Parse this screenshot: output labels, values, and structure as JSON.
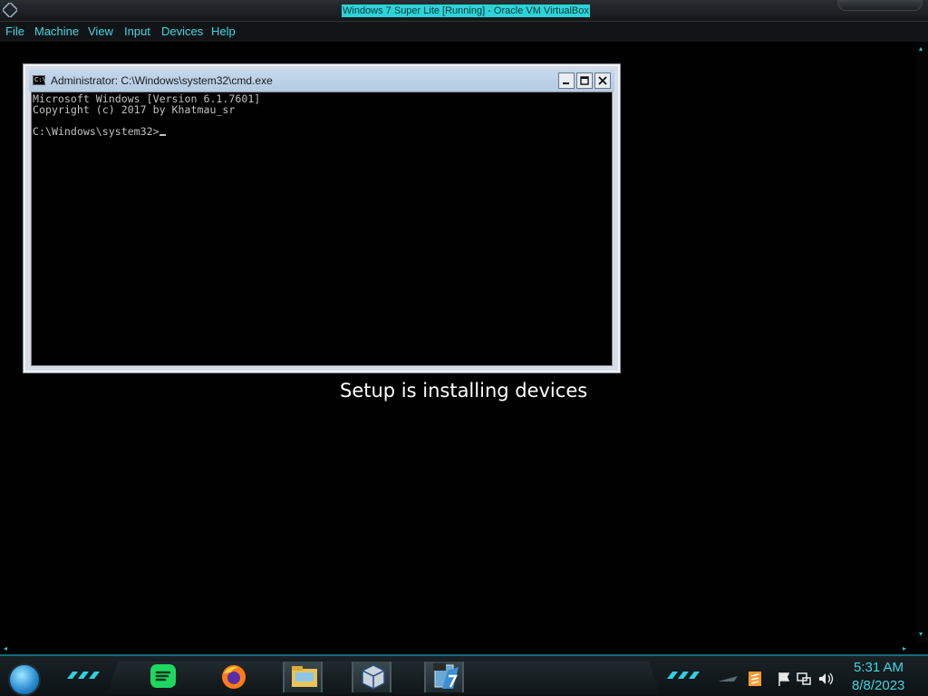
{
  "host": {
    "title": "Windows 7 Super Lite [Running] - Oracle VM VirtualBox",
    "menu": [
      "File",
      "Machine",
      "View",
      "Input",
      "Devices",
      "Help"
    ]
  },
  "cmd": {
    "title": "Administrator: C:\\Windows\\system32\\cmd.exe",
    "icon_text": "C:\\",
    "lines": [
      "Microsoft Windows [Version 6.1.7601]",
      "Copyright (c) 2017 by Khatmau_sr",
      "",
      "C:\\Windows\\system32>"
    ]
  },
  "setup": {
    "status": "Setup is installing devices"
  },
  "taskbar": {
    "pinned": [
      "spotify-icon",
      "firefox-icon",
      "file-explorer-icon",
      "virtualbox-icon",
      "windows7-64bit-icon"
    ],
    "tray": [
      "expand-tray-icon",
      "sublime-text-icon",
      "action-center-flag-icon",
      "network-icon",
      "volume-icon"
    ],
    "time": "5:31 AM",
    "date": "8/8/2023"
  },
  "colors": {
    "accent": "#3fd6e4",
    "title_highlight": "#2cd4d8",
    "console_text": "#c0c0c0"
  }
}
